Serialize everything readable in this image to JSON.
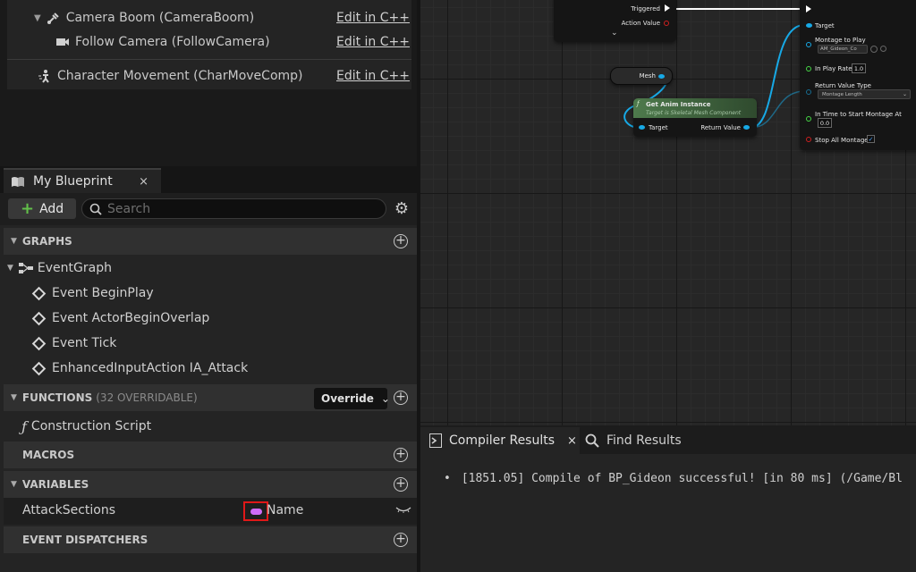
{
  "components": {
    "items": [
      {
        "label": "Camera Boom (CameraBoom)",
        "edit": "Edit in C++"
      },
      {
        "label": "Follow Camera (FollowCamera)",
        "edit": "Edit in C++"
      },
      {
        "label": "Character Movement (CharMoveComp)",
        "edit": "Edit in C++"
      }
    ]
  },
  "my_blueprint": {
    "tab_label": "My Blueprint",
    "tab_close": "×",
    "add_label": "Add",
    "search_placeholder": "Search",
    "sections": {
      "graphs": "GRAPHS",
      "functions": "FUNCTIONS",
      "functions_sub": "(32 OVERRIDABLE)",
      "macros": "MACROS",
      "variables": "VARIABLES",
      "event_dispatchers": "EVENT DISPATCHERS"
    },
    "graph_root": "EventGraph",
    "events": [
      "Event BeginPlay",
      "Event ActorBeginOverlap",
      "Event Tick",
      "EnhancedInputAction IA_Attack"
    ],
    "override_label": "Override",
    "function_items": [
      "Construction Script"
    ],
    "variable": {
      "name": "AttackSections",
      "type": "Name",
      "type_color": "#cf6cf7"
    }
  },
  "graph": {
    "nodes": {
      "input_action": {
        "triggered": "Triggered",
        "action_value": "Action Value"
      },
      "mesh": "Mesh",
      "get_anim_instance": {
        "title": "Get Anim Instance",
        "subtitle": "Target is Skeletal Mesh Component",
        "target": "Target",
        "return_value": "Return Value"
      },
      "play_montage": {
        "target": "Target",
        "montage_label": "Montage to Play",
        "montage_value": "AM_Gideon_Co",
        "play_rate_label": "In Play Rate",
        "play_rate_value": "1.0",
        "return_type_label": "Return Value Type",
        "return_type_value": "Montage Length",
        "start_at_label": "In Time to Start Montage At",
        "start_at_value": "0.0",
        "stop_all_label": "Stop All Montages"
      }
    }
  },
  "bottom": {
    "tab_compiler": "Compiler Results",
    "tab_close": "×",
    "tab_find": "Find Results",
    "result": "[1851.05] Compile of BP_Gideon successful! [in 80 ms] (/Game/Bl"
  }
}
